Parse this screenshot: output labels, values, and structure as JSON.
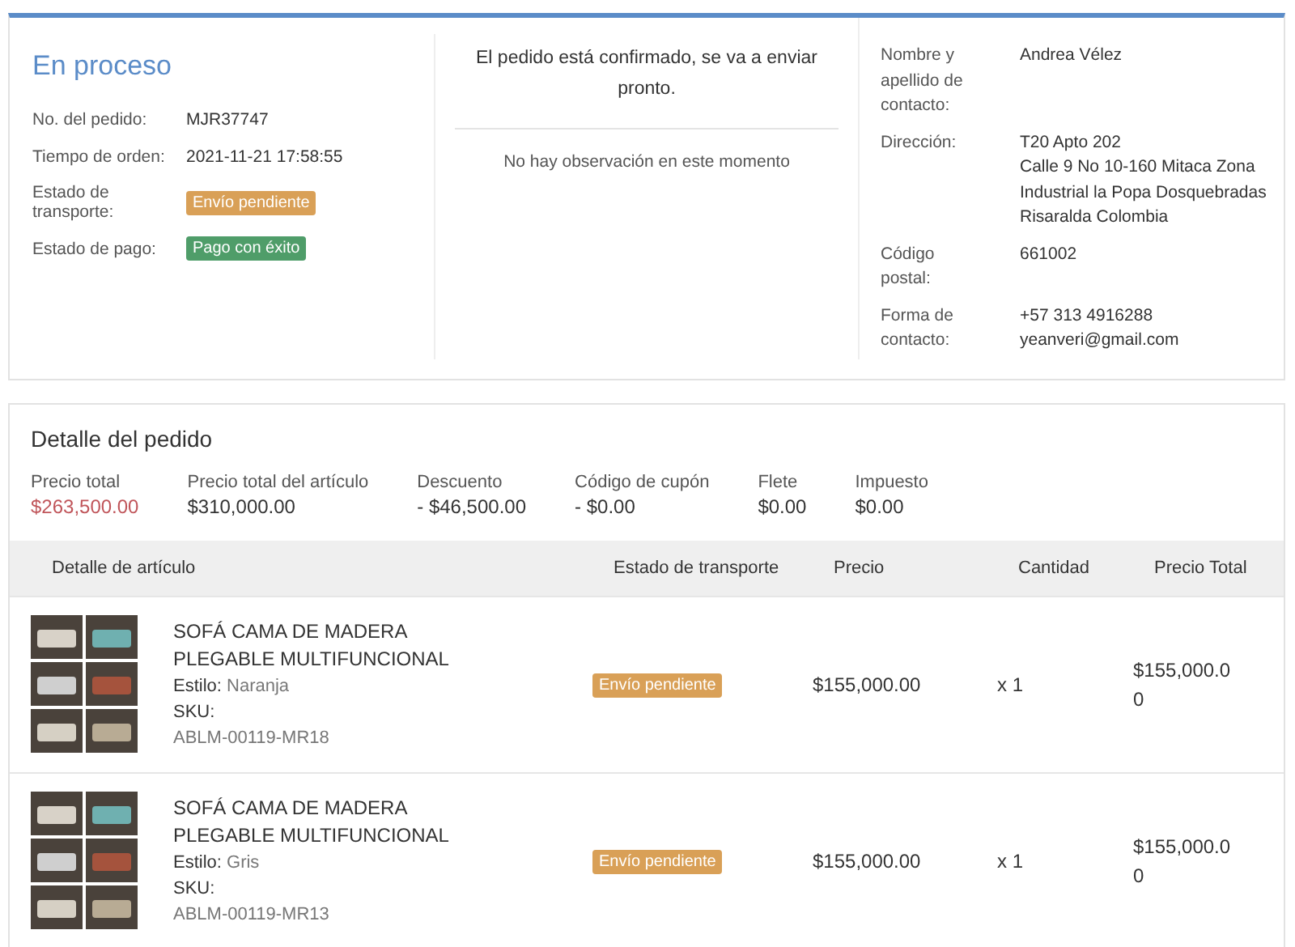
{
  "order_status": {
    "title": "En proceso",
    "fields": [
      {
        "label": "No. del pedido:",
        "value": "MJR37747",
        "kind": "text"
      },
      {
        "label": "Tiempo de orden:",
        "value": "2021-11-21 17:58:55",
        "kind": "text"
      },
      {
        "label": "Estado de transporte:",
        "value": "Envío pendiente",
        "kind": "badge",
        "color": "#d9a057"
      },
      {
        "label": "Estado de pago:",
        "value": "Pago con éxito",
        "kind": "badge",
        "color": "#4f9d69"
      }
    ]
  },
  "message": {
    "text": "El pedido está confirmado, se va a enviar pronto.",
    "remark": "No hay observación en este momento"
  },
  "contact": [
    {
      "label": "Nombre y apellido de contacto:",
      "lines": [
        "Andrea Vélez"
      ]
    },
    {
      "label": "Dirección:",
      "lines": [
        "T20 Apto 202",
        "Calle 9 No 10-160 Mitaca Zona Industrial la Popa Dosquebradas Risaralda Colombia"
      ]
    },
    {
      "label": "Código postal:",
      "lines": [
        "661002"
      ]
    },
    {
      "label": "Forma de contacto:",
      "lines": [
        "+57 313 4916288",
        "yeanveri@gmail.com"
      ]
    }
  ],
  "order_detail": {
    "title": "Detalle del pedido",
    "summary": [
      {
        "label": "Precio total",
        "value": "$263,500.00",
        "kind": "highlight"
      },
      {
        "label": "Precio total del artículo",
        "value": "$310,000.00",
        "kind": "plain"
      },
      {
        "label": "Descuento",
        "value": "- $46,500.00",
        "kind": "plain"
      },
      {
        "label": "Código de cupón",
        "value": "- $0.00",
        "kind": "plain"
      },
      {
        "label": "Flete",
        "value": "$0.00",
        "kind": "plain"
      },
      {
        "label": "Impuesto",
        "value": "$0.00",
        "kind": "plain"
      }
    ],
    "table": {
      "columns": [
        "Detalle de artículo",
        "Estado de transporte",
        "Precio",
        "Cantidad",
        "Precio Total"
      ],
      "rows": [
        {
          "name": "SOFÁ CAMA DE MADERA PLEGABLE MULTIFUNCIONAL",
          "style_label": "Estilo:",
          "style": "Naranja",
          "sku_label": "SKU:",
          "sku": "ABLM-00119-MR18",
          "status": {
            "text": "Envío pendiente",
            "color": "#d9a057"
          },
          "price": "$155,000.00",
          "quantity": "x 1",
          "total": "$155,000.00"
        },
        {
          "name": "SOFÁ CAMA DE MADERA PLEGABLE MULTIFUNCIONAL",
          "style_label": "Estilo:",
          "style": "Gris",
          "sku_label": "SKU:",
          "sku": "ABLM-00119-MR13",
          "status": {
            "text": "Envío pendiente",
            "color": "#d9a057"
          },
          "price": "$155,000.00",
          "quantity": "x 1",
          "total": "$155,000.00"
        }
      ]
    }
  }
}
